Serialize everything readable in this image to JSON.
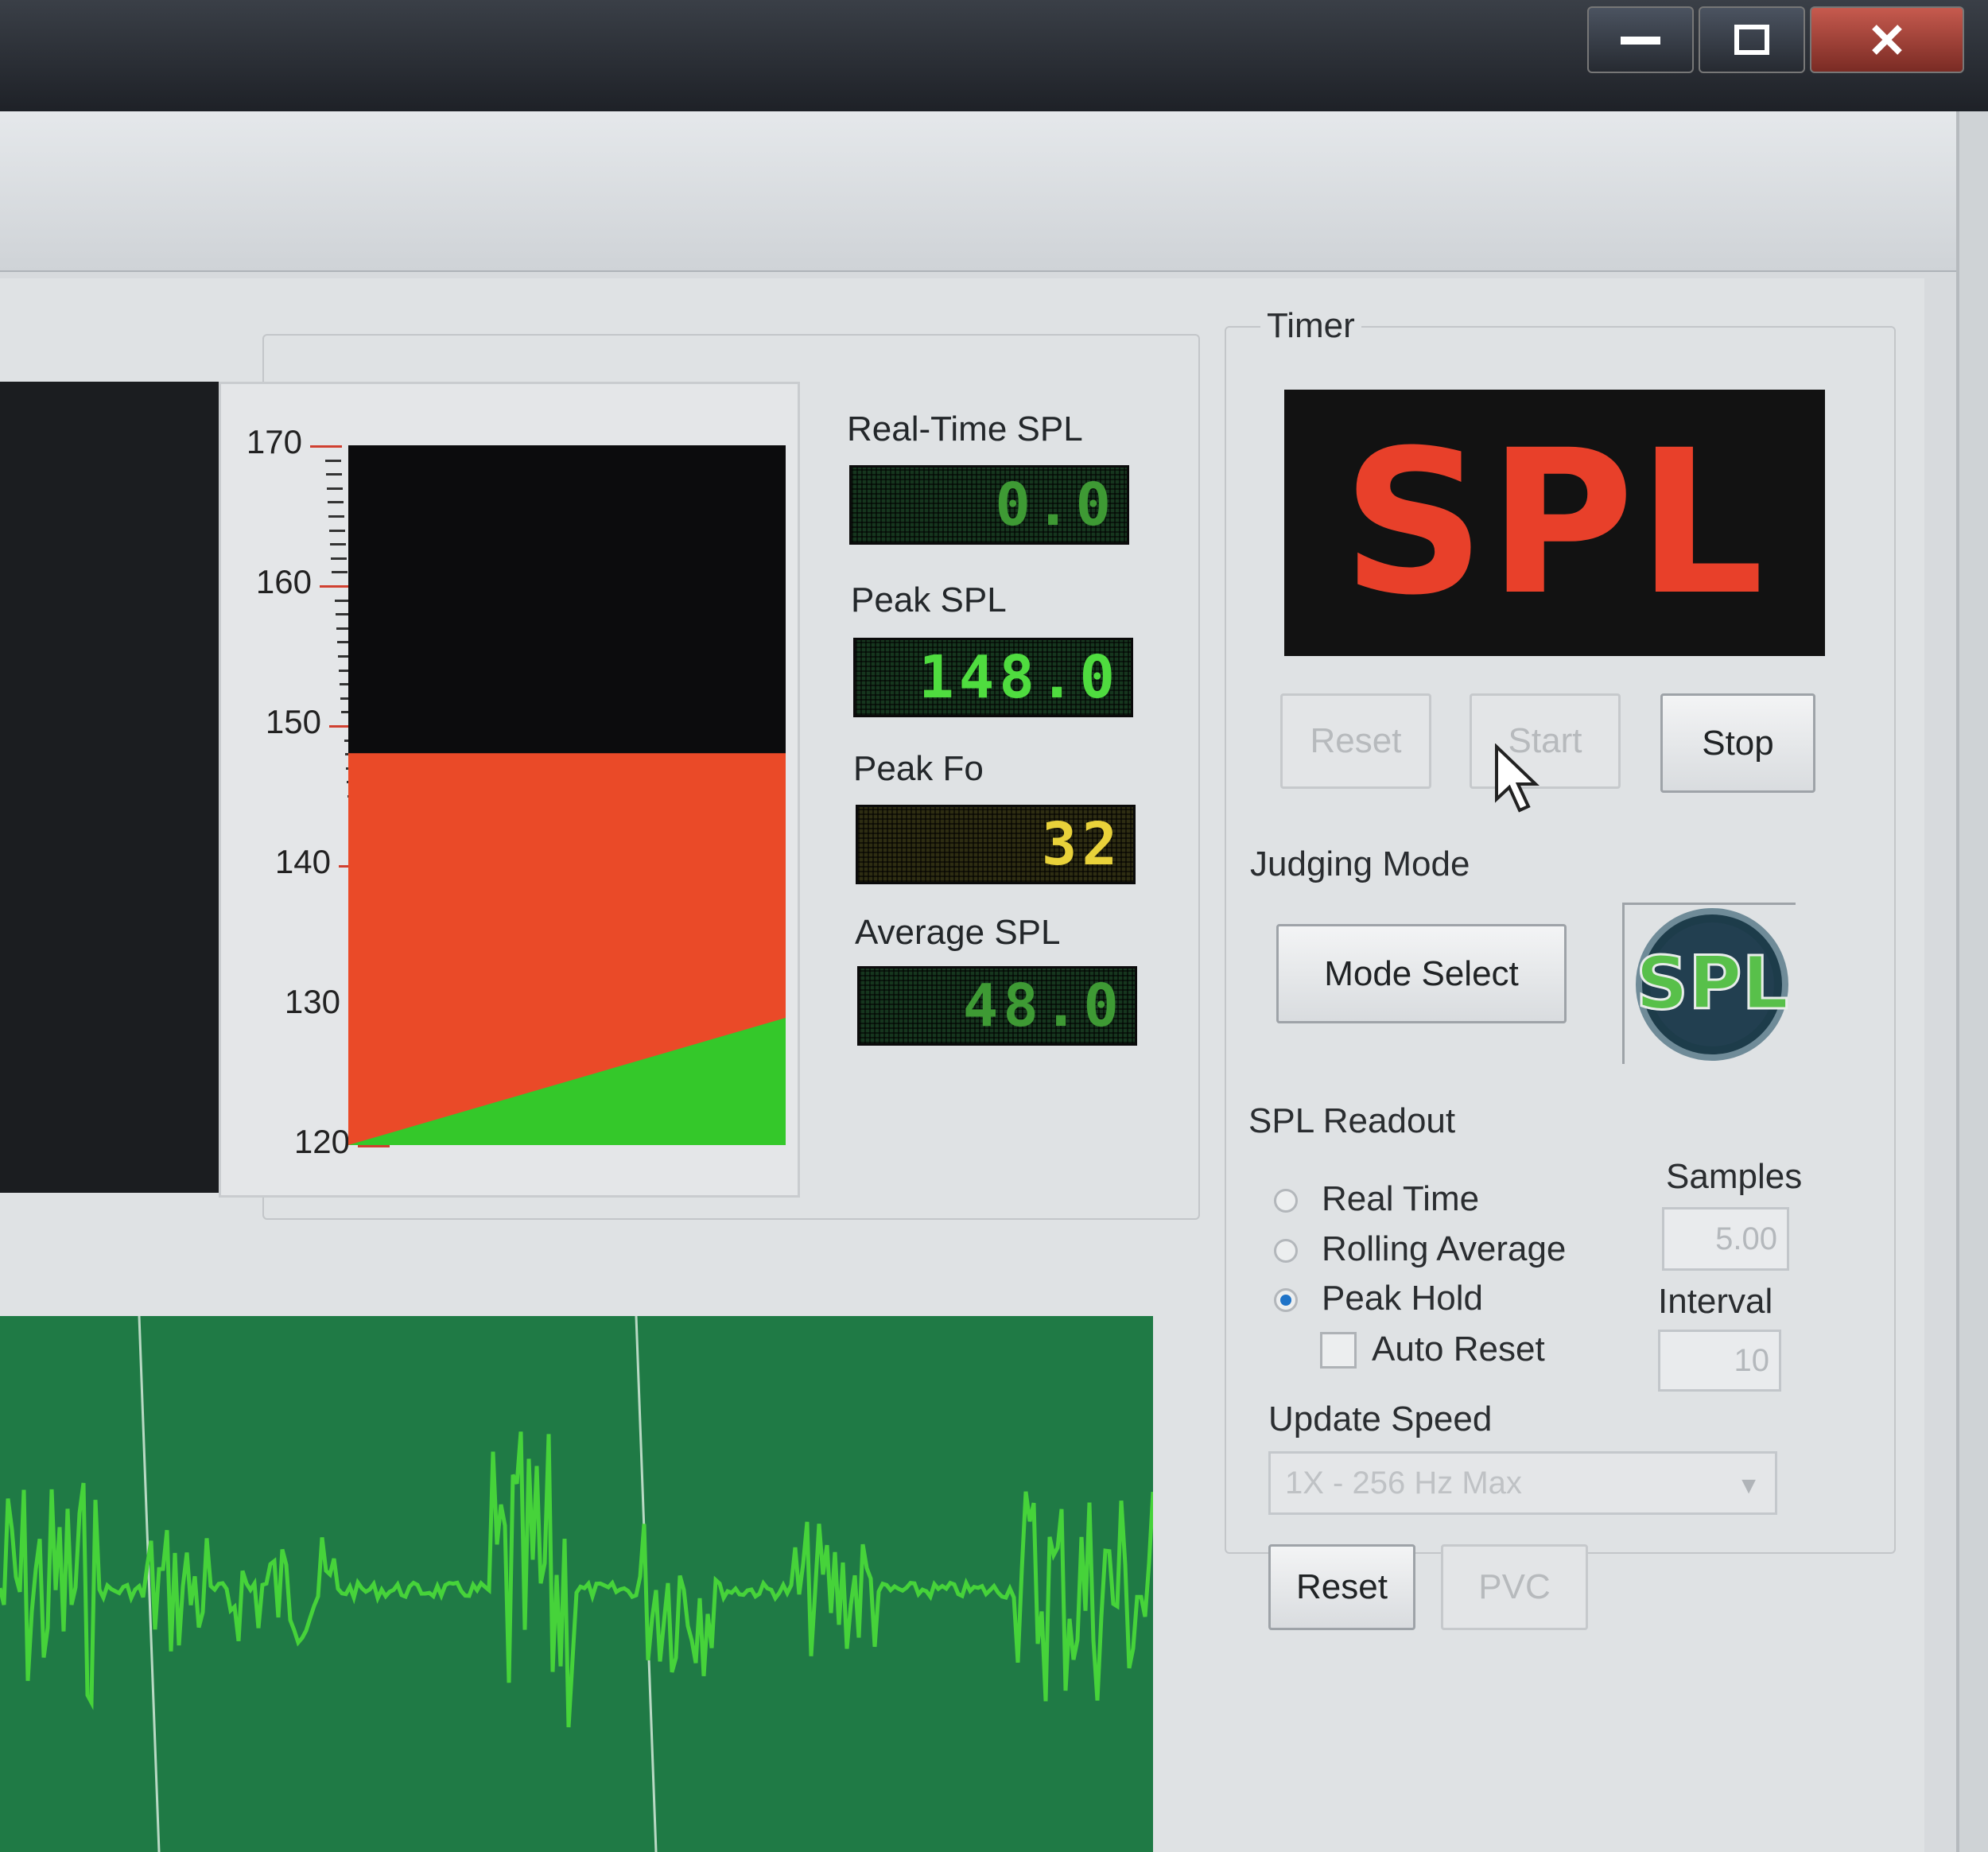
{
  "window": {
    "minimize_label": "—",
    "maximize_label": "□",
    "close_label": "X"
  },
  "meter": {
    "ticks": [
      "170",
      "160",
      "150",
      "140",
      "130",
      "120"
    ],
    "scale_min": 120,
    "scale_max": 170,
    "level_value": 148.0,
    "colors": {
      "background": "#0c0c0d",
      "level": "#ea4a28",
      "trend": "#34c82a"
    }
  },
  "readouts": {
    "realtime_label": "Real-Time SPL",
    "realtime_value": "0.0",
    "peak_label": "Peak SPL",
    "peak_value": "148.0",
    "peakfo_label": "Peak Fo",
    "peakfo_value": "32",
    "average_label": "Average SPL",
    "average_value": "48.0"
  },
  "timer": {
    "label": "Timer",
    "display_text": "SPL",
    "reset_label": "Reset",
    "start_label": "Start",
    "stop_label": "Stop"
  },
  "judging": {
    "label": "Judging Mode",
    "mode_select_label": "Mode Select",
    "logo_text": "SPL"
  },
  "spl_readout": {
    "label": "SPL Readout",
    "options": [
      "Real Time",
      "Rolling Average",
      "Peak Hold"
    ],
    "selected": "Peak Hold",
    "auto_reset_label": "Auto Reset",
    "samples_label": "Samples",
    "samples_value": "5.00",
    "interval_label": "Interval",
    "interval_value": "10"
  },
  "update_speed": {
    "label": "Update Speed",
    "value": "1X - 256 Hz Max"
  },
  "bottom": {
    "reset_label": "Reset",
    "pvc_label": "PVC"
  },
  "scope": {
    "background": "#1f7a45",
    "trace_color": "#46d33a"
  }
}
